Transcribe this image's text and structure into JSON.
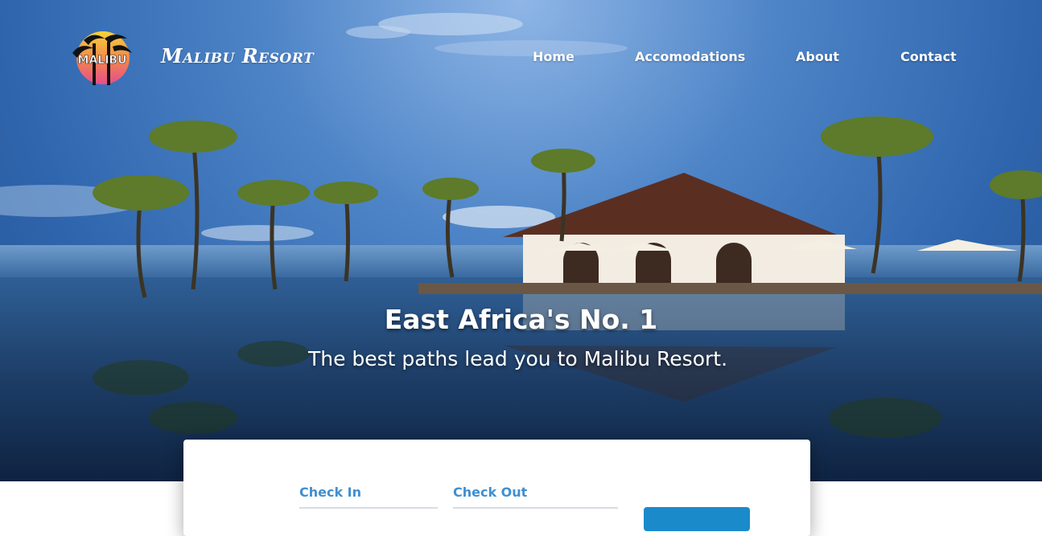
{
  "header": {
    "brand_name": "Malibu Resort",
    "logo_text": "MALIBU"
  },
  "nav": {
    "items": [
      {
        "label": "Home"
      },
      {
        "label": "Accomodations"
      },
      {
        "label": "About"
      },
      {
        "label": "Contact"
      }
    ]
  },
  "hero": {
    "title": "East Africa's No. 1",
    "subtitle": "The best paths lead you to Malibu Resort."
  },
  "booking": {
    "check_in_label": "Check In",
    "check_out_label": "Check Out"
  },
  "colors": {
    "accent": "#3f8fd0",
    "button": "#1a8acb",
    "text_on_hero": "#ffffff"
  }
}
